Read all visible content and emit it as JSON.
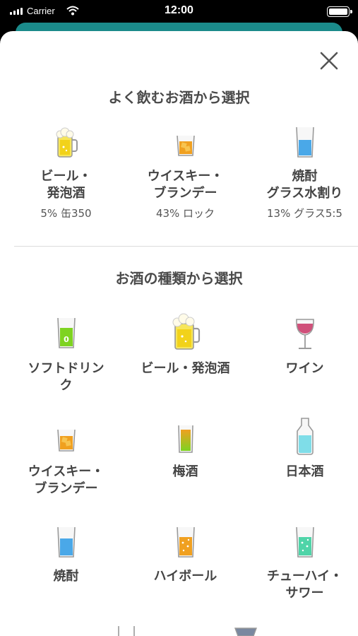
{
  "status_bar": {
    "carrier": "Carrier",
    "time": "12:00"
  },
  "close_icon": "close-x-icon",
  "favorites": {
    "title": "よく飲むお酒から選択",
    "items": [
      {
        "label": "ビール・\n発泡酒",
        "sub": "5% 缶350",
        "icon": "beer-mug-icon"
      },
      {
        "label": "ウイスキー・\nブランデー",
        "sub": "43% ロック",
        "icon": "whisky-glass-icon"
      },
      {
        "label": "焼酎\nグラス水割り",
        "sub": "13% グラス5:5",
        "icon": "shochu-glass-icon"
      }
    ]
  },
  "kinds": {
    "title": "お酒の種類から選択",
    "items": [
      {
        "label": "ソフトドリン\nク",
        "icon": "soft-drink-glass-icon",
        "badge": "0"
      },
      {
        "label": "ビール・発泡酒",
        "icon": "beer-mug-icon"
      },
      {
        "label": "ワイン",
        "icon": "wine-glass-icon"
      },
      {
        "label": "ウイスキー・\nブランデー",
        "icon": "whisky-glass-icon"
      },
      {
        "label": "梅酒",
        "icon": "umeshu-glass-icon"
      },
      {
        "label": "日本酒",
        "icon": "sake-bottle-icon"
      },
      {
        "label": "焼酎",
        "icon": "shochu-glass-icon"
      },
      {
        "label": "ハイボール",
        "icon": "highball-glass-icon"
      },
      {
        "label": "チューハイ・\nサワー",
        "icon": "chuhai-glass-icon"
      }
    ]
  },
  "colors": {
    "header_teal": "#1b8b8b",
    "beer": "#f2d21a",
    "whisky": "#f0a020",
    "water": "#4aa8e8",
    "wine": "#d0507a",
    "soft_drink": "#7ed321",
    "sake": "#7fdde8",
    "chuhai": "#4fd4a8"
  }
}
